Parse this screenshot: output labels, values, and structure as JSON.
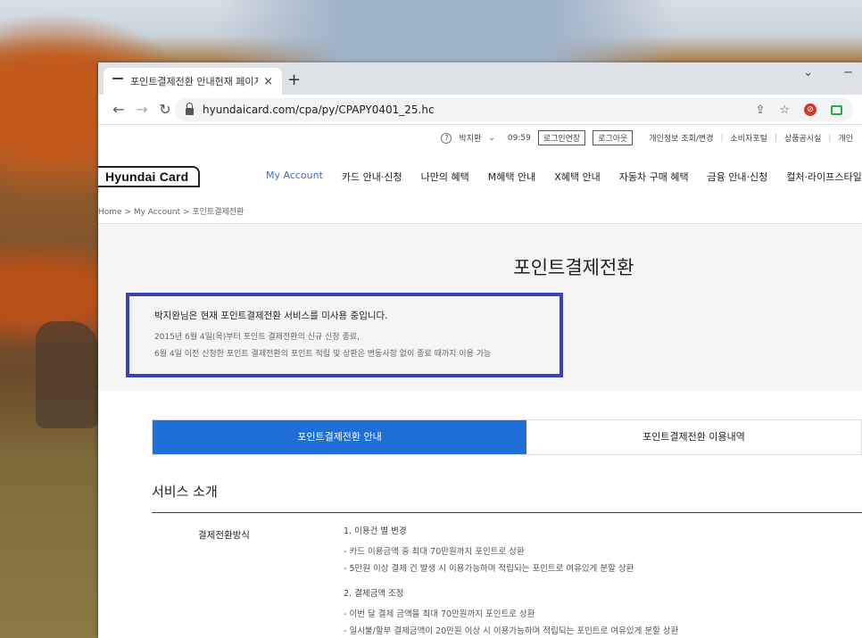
{
  "browser": {
    "tab_title": "포인트결제전환 안내현재 페이지",
    "tab_close": "×",
    "new_tab": "+",
    "url": "hyundaicard.com/cpa/py/CPAPY0401_25.hc",
    "win_min": "−",
    "win_chevron": "⌄"
  },
  "util": {
    "help": "?",
    "user": "박지환",
    "caret": "⌄",
    "time": "09:59",
    "extend": "로그인연장",
    "logout": "로그아웃",
    "links": [
      "개인정보 조회/변경",
      "소비자포털",
      "상품공시실",
      "개인"
    ]
  },
  "logo": "Hyundai Card",
  "menu": [
    "My Account",
    "카드 안내·신청",
    "나만의 혜택",
    "M혜택 안내",
    "X혜택 안내",
    "자동차 구매 혜택",
    "금융 안내·신청",
    "컬처·라이프스타일"
  ],
  "breadcrumb": "Home  >  My Account  >  포인트결제전환",
  "page_title": "포인트결제전환",
  "notice": {
    "main": "박지완님은 현재 포인트결제전환 서비스를 미사용 중입니다.",
    "line1": "2015년 6월 4일(목)부터 포인트 결제전환의 신규 신청 종료,",
    "line2": "6월 4일 이전 신청한 포인트 결제전환의 포인트 적립 및 상환은 변동사항 없이 종료 때까지 이용 가능"
  },
  "tabs": [
    "포인트결제전환 안내",
    "포인트결제전환 이용내역"
  ],
  "section": {
    "title": "서비스 소개",
    "label": "결제전환방식",
    "h1": "1. 이용건 별 변경",
    "h1_items": [
      "- 카드 이용금액 중 최대 70만원까지 포인트로 상환",
      "- 5만원 이상 결제 건 발생 시 이용가능하며 적립되는 포인트로 여유있게 분할 상환"
    ],
    "h2": "2. 결제금액 조정",
    "h2_items": [
      "- 이번 달 결제 금액을 최대 70만원까지 포인트로 상환",
      "- 일시불/할부 결제금액이 20만원 이상 시 이용가능하며 적립되는 포인트로 여유있게 분할 상환"
    ]
  }
}
